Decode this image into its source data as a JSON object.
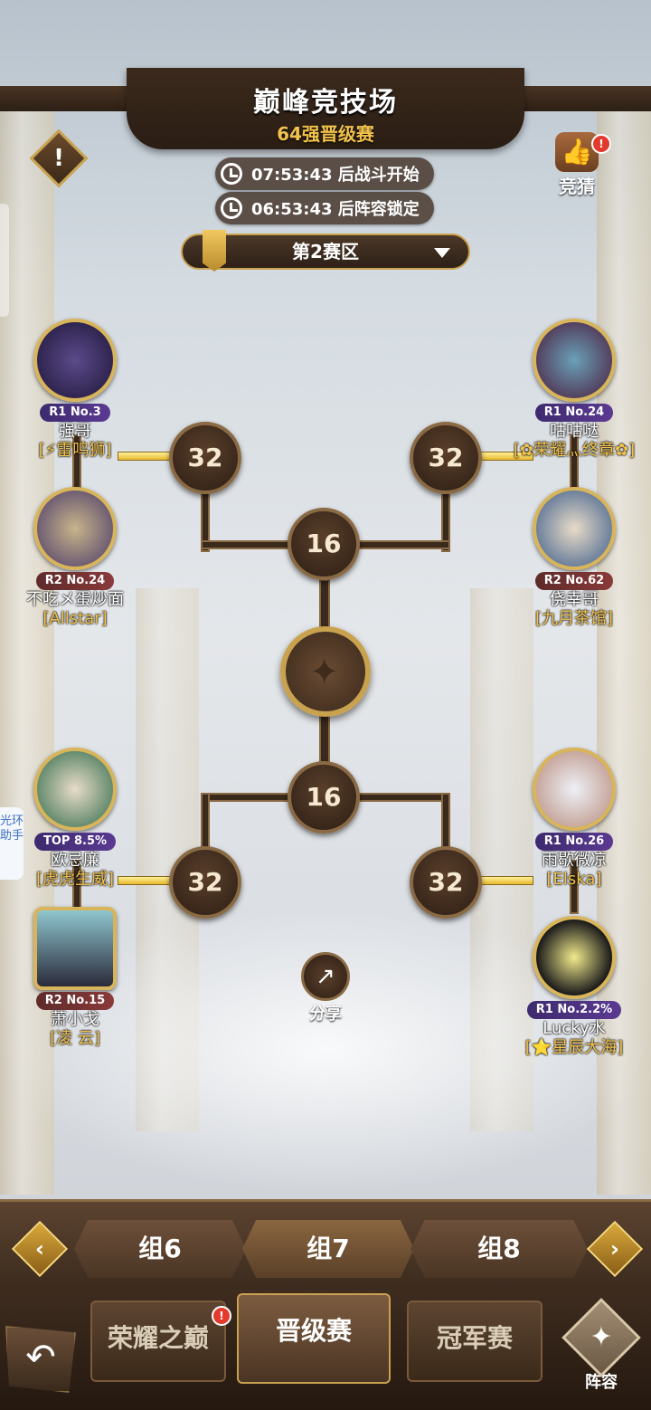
{
  "header": {
    "title": "巅峰竞技场",
    "subtitle": "64强晋级赛",
    "battle_timer": "07:53:43 后战斗开始",
    "lock_timer": "06:53:43 后阵容锁定",
    "zone_label": "第2赛区",
    "alert_glyph": "!",
    "guess_label": "竞猜",
    "guess_badge": "!"
  },
  "bracket": {
    "round_labels": [
      "32",
      "32",
      "16",
      "16",
      "32",
      "32"
    ]
  },
  "players": [
    {
      "rank": "R1 No.3",
      "name": "强哥",
      "guild": "[⚡雷鸣狮]"
    },
    {
      "rank": "R2 No.24",
      "name": "不吃メ蛋炒面",
      "guild": "[Allstar]"
    },
    {
      "rank": "R1 No.24",
      "name": "咕咕哒",
      "guild": "[✿荣耀灬终章✿]"
    },
    {
      "rank": "R2 No.62",
      "name": "侥幸哥",
      "guild": "[九月茶馆]"
    },
    {
      "rank": "TOP 8.5%",
      "name": "欧忌廉",
      "guild": "[虎虎生威]"
    },
    {
      "rank": "R2 No.15",
      "name": "萧小戈",
      "guild": "[凌 云]"
    },
    {
      "rank": "R1 No.26",
      "name": "雨歇微凉",
      "guild": "[Elska]"
    },
    {
      "rank": "R1 No.2.2%",
      "name": "Lucky水",
      "guild": "[⭐星辰大海]"
    }
  ],
  "share_label": "分享",
  "side_tab_label": "光环助手",
  "groups": {
    "prev": "组6",
    "current": "组7",
    "next": "组8"
  },
  "nav": {
    "glory": "荣耀之巅",
    "glory_badge": "!",
    "promotion": "晋级赛",
    "champion": "冠军赛",
    "formation": "阵容",
    "back_glyph": "↶"
  },
  "colors": {
    "gold": "#f2c24c",
    "panel_dark": "#2c1e14",
    "frame_bronze": "#8a6a45"
  }
}
